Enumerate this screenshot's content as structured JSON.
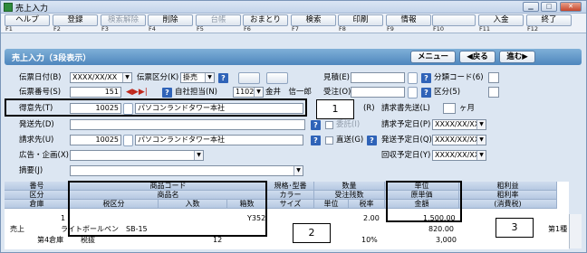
{
  "window": {
    "title": "売上入力"
  },
  "toolbar": [
    {
      "label": "ヘルプ",
      "key": "F1",
      "enabled": true
    },
    {
      "label": "登録",
      "key": "F2",
      "enabled": true
    },
    {
      "label": "検索解除",
      "key": "F3",
      "enabled": false
    },
    {
      "label": "削除",
      "key": "F4",
      "enabled": true
    },
    {
      "label": "台帳",
      "key": "F5",
      "enabled": false
    },
    {
      "label": "おまとり",
      "key": "F6",
      "enabled": true
    },
    {
      "label": "検索",
      "key": "F7",
      "enabled": true
    },
    {
      "label": "印刷",
      "key": "F8",
      "enabled": true
    },
    {
      "label": "情報",
      "key": "F9",
      "enabled": true
    },
    {
      "label": "",
      "key": "F10",
      "enabled": true
    },
    {
      "label": "入金",
      "key": "F11",
      "enabled": true
    },
    {
      "label": "終了",
      "key": "F12",
      "enabled": true
    }
  ],
  "header": {
    "title": "売上入力（3段表示）",
    "menu": "メニュー",
    "prev": "◀戻る",
    "next": "進む▶"
  },
  "form": {
    "date_label": "伝票日付(B)",
    "date_value": "XXXX/XX/XX",
    "kubun_label": "伝票区分(K)",
    "kubun_value": "掛売",
    "mitsumori_label": "見積(E)",
    "bunrui_label": "分類コード(6)",
    "denpyo_no_label": "伝票番号(S)",
    "denpyo_no_value": "151",
    "jisha_label": "自社担当(N)",
    "jisha_code": "1102",
    "jisha_name": "金井　信一郎",
    "jutyu_label": "受注(O)",
    "kubun2_label": "区分(5)",
    "tokuisaki_label": "得意先(T)",
    "tokuisaki_code": "10025",
    "tokuisaki_name": "パソコンランドタワー本社",
    "ryaku_label": "(R)",
    "seikyusho_label": "請求書先送(L)",
    "seikyusho_unit": "ヶ月",
    "hassosaki_label": "発送先(D)",
    "itaku_label": "委託(I)",
    "seikyu_yotei_label": "請求予定日(P)",
    "seikyu_yotei_value": "XXXX/XX/XX",
    "seikyusaki_label": "請求先(U)",
    "seikyusaki_code": "10025",
    "seikyusaki_name": "パソコンランドタワー本社",
    "chokuso_label": "直送(G)",
    "hasso_yotei_label": "発送予定日(Q)",
    "hasso_yotei_value": "XXXX/XX/XX",
    "kokoku_label": "広告・企画(X)",
    "kaishu_yotei_label": "回収予定日(Y)",
    "kaishu_yotei_value": "XXXX/XX/XX",
    "tekiyo_label": "摘要(J)"
  },
  "grid": {
    "headers_row1": [
      "番号",
      "商品コード",
      "規格･型番",
      "数量",
      "単位",
      "粗利益"
    ],
    "headers_row2": [
      "区分",
      "商品名",
      "カラー",
      "受注残数",
      "原単価",
      "粗利率"
    ],
    "headers_row3": [
      "倉庫",
      "税区分",
      "入数",
      "箱数",
      "サイズ",
      "単位",
      "税率",
      "金額",
      "(消費税)"
    ],
    "row": {
      "no": "1",
      "code": "Y352",
      "qty": "2.00",
      "tanka": "1,500.00",
      "kubun": "売上",
      "name": "ライトボールペン　SB-15",
      "genka": "820.00",
      "souko": "第4倉庫",
      "zeikubun": "税抜",
      "irisu": "12",
      "zeiritsu": "10%",
      "kingaku": "3,000",
      "extra": "第1種"
    }
  },
  "callouts": [
    "1",
    "2",
    "3"
  ]
}
